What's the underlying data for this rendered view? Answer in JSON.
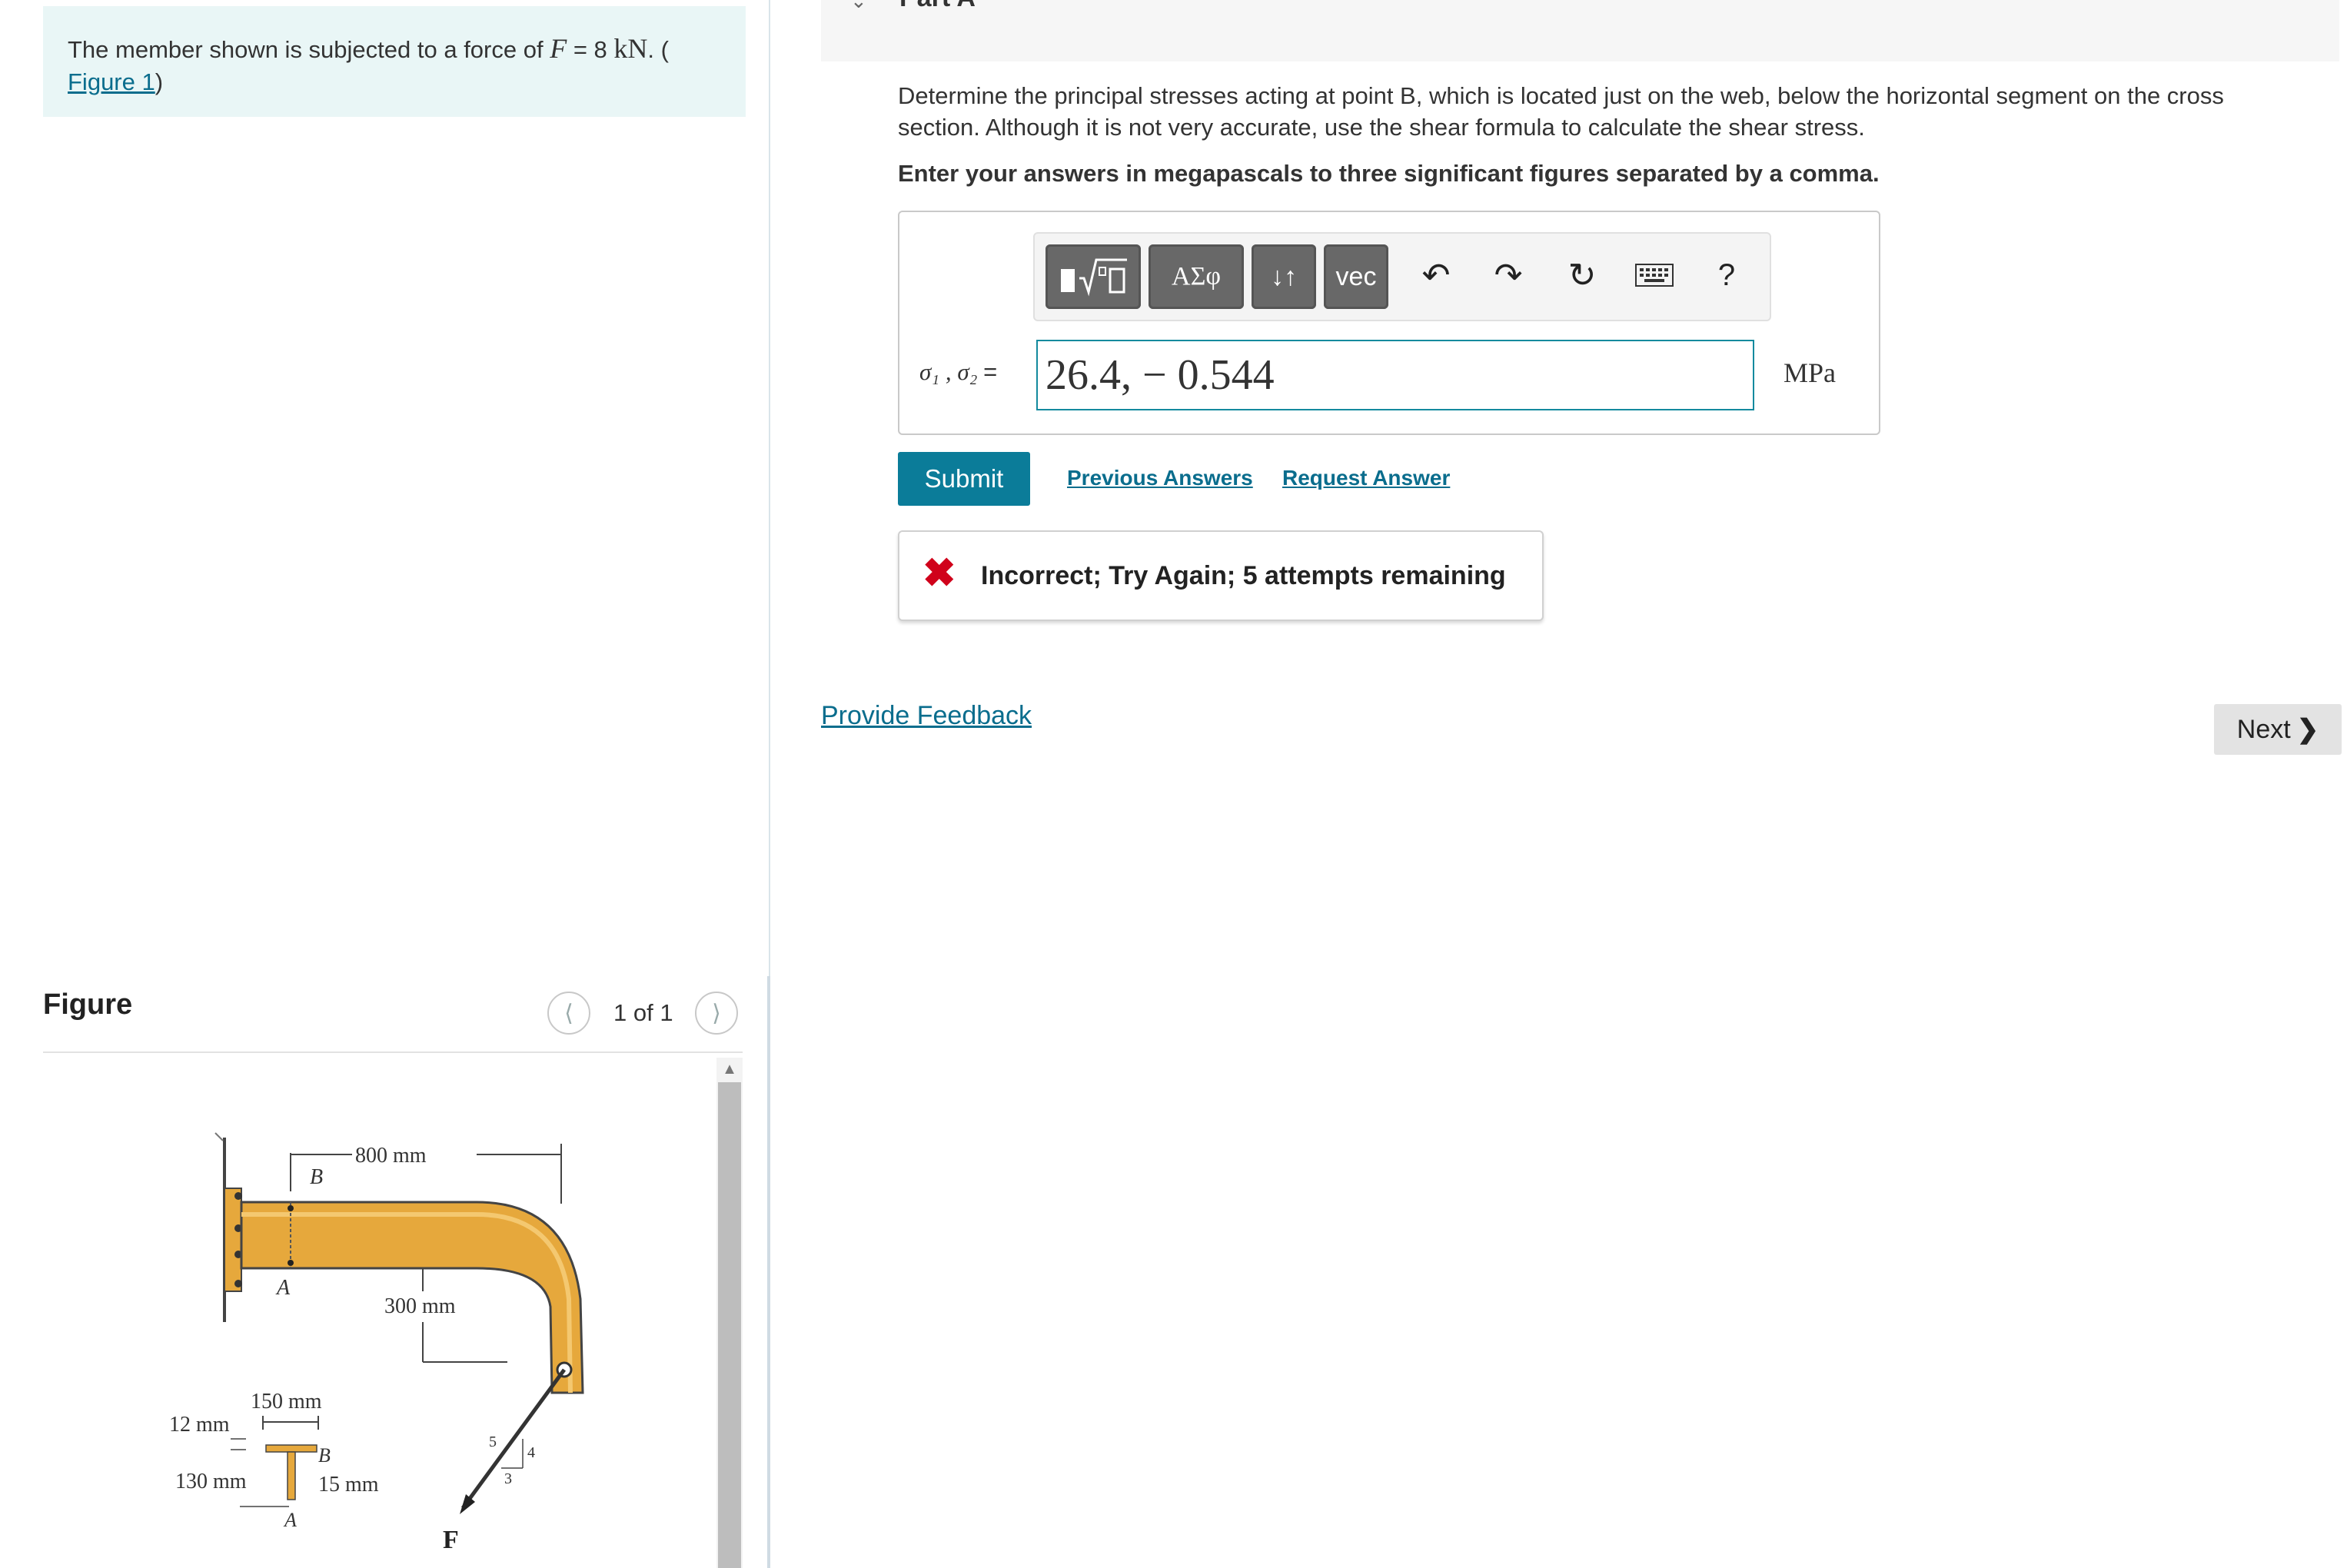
{
  "problem": {
    "text_before": "The member shown is subjected to a force of ",
    "var": "F",
    "equals": " = 8 ",
    "unit": "kN",
    "text_after": ". (",
    "figure_link": "Figure 1",
    "close_paren": ")"
  },
  "figure_panel": {
    "title": "Figure",
    "pager_text": "1 of 1",
    "prev_icon": "chevron-left-icon",
    "next_icon": "chevron-right-icon"
  },
  "figure": {
    "dim_800": "800 mm",
    "dim_300": "300 mm",
    "dim_150": "150 mm",
    "dim_12": "12 mm",
    "dim_130": "130 mm",
    "dim_15": "15 mm",
    "label_B": "B",
    "label_A": "A",
    "label_B2": "B",
    "label_A2": "A",
    "label_F": "F",
    "slope_5": "5",
    "slope_4": "4",
    "slope_3": "3",
    "member_color": "#e6a83c"
  },
  "part": {
    "title": "Part A",
    "question": "Determine the principal stresses acting at point B, which is located just on the web, below the horizontal segment on the cross section. Although it is not very accurate, use the shear formula to calculate the shear stress.",
    "instruction": "Enter your answers in megapascals to three significant figures separated by a comma."
  },
  "toolbar": {
    "templates_icon": "templates-icon",
    "greek_label": "ΑΣφ",
    "arrows_label": "↓↑",
    "vec_label": "vec",
    "undo_icon": "undo-icon",
    "redo_icon": "redo-icon",
    "reset_icon": "reset-icon",
    "keyboard_icon": "keyboard-icon",
    "help_label": "?"
  },
  "answer": {
    "label_sigma": "σ₁ , σ₂",
    "label_eq": "=",
    "value": "26.4, − 0.544",
    "unit": "MPa"
  },
  "actions": {
    "submit": "Submit",
    "previous_answers": "Previous Answers",
    "request_answer": "Request Answer"
  },
  "feedback": {
    "icon": "✖",
    "text": "Incorrect; Try Again; 5 attempts remaining"
  },
  "footer": {
    "provide_feedback": "Provide Feedback",
    "next": "Next"
  },
  "colors": {
    "accent": "#0b7c99",
    "link": "#0a6d8d",
    "error": "#d0021b",
    "problem_bg": "#e9f6f6"
  }
}
